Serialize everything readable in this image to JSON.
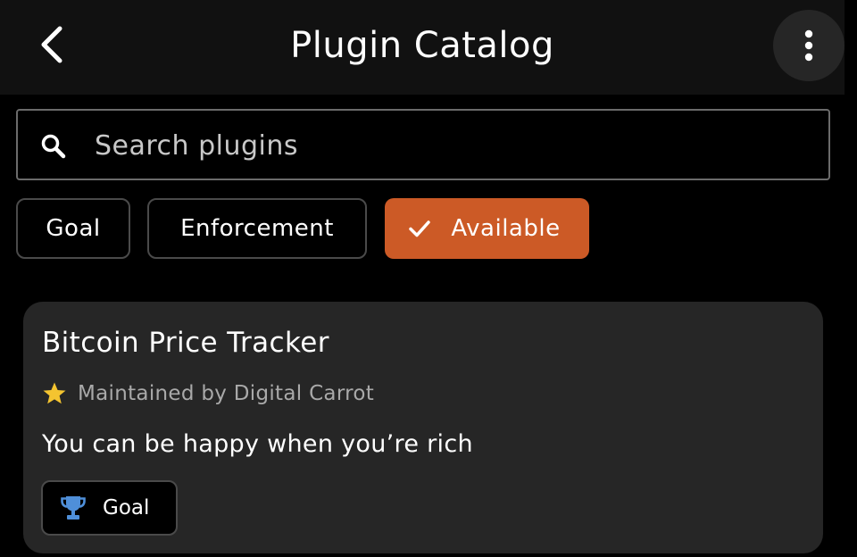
{
  "header": {
    "title": "Plugin Catalog",
    "back_icon": "chevron-left-icon",
    "more_icon": "more-vertical-icon"
  },
  "search": {
    "placeholder": "Search plugins",
    "value": "",
    "icon": "search-icon"
  },
  "filters": [
    {
      "label": "Goal",
      "selected": false
    },
    {
      "label": "Enforcement",
      "selected": false
    },
    {
      "label": "Available",
      "selected": true,
      "icon": "check-icon"
    }
  ],
  "plugins": [
    {
      "name": "Bitcoin Price Tracker",
      "maintainer": "Maintained by Digital Carrot",
      "maintainer_icon": "star-icon",
      "description": "You can be happy when you’re rich",
      "tag": {
        "label": "Goal",
        "icon": "trophy-icon"
      }
    }
  ],
  "colors": {
    "accent": "#cc5a26",
    "background": "#000000",
    "header_bg": "#111111",
    "card_bg": "#262626",
    "star": "#f4c430",
    "trophy": "#4f8fd9"
  }
}
